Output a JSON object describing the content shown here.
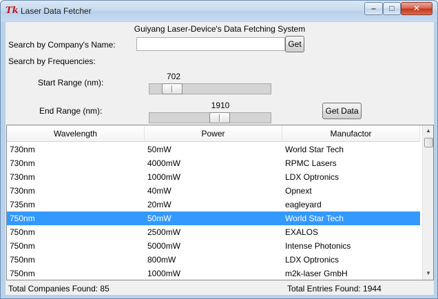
{
  "window": {
    "title": "Laser Data Fetcher",
    "icon": "tk-feather-icon"
  },
  "header": {
    "title": "Guiyang Laser-Device's Data Fetching System"
  },
  "search": {
    "company_label": "Search by Company's Name:",
    "company_value": "",
    "get_label": "Get",
    "freq_label": "Search by Frequencies:"
  },
  "range": {
    "start_label": "Start Range (nm):",
    "start_value": "702",
    "end_label": "End Range (nm):",
    "end_value": "1910",
    "get_data_label": "Get Data"
  },
  "table": {
    "columns": [
      "Wavelength",
      "Power",
      "Manufactor"
    ],
    "rows": [
      [
        "730nm",
        "50mW",
        "World Star Tech"
      ],
      [
        "730nm",
        "4000mW",
        "RPMC Lasers"
      ],
      [
        "730nm",
        "1000mW",
        "LDX Optronics"
      ],
      [
        "730nm",
        "40mW",
        "Opnext"
      ],
      [
        "735nm",
        "20mW",
        "eagleyard"
      ],
      [
        "750nm",
        "50mW",
        "World Star Tech"
      ],
      [
        "750nm",
        "2500mW",
        "EXALOS"
      ],
      [
        "750nm",
        "5000mW",
        "Intense Photonics"
      ],
      [
        "750nm",
        "800mW",
        "LDX Optronics"
      ],
      [
        "750nm",
        "1000mW",
        "m2k-laser GmbH"
      ]
    ],
    "selected_row": 5
  },
  "footer": {
    "companies": "Total Companies Found: 85",
    "entries": "Total Entries Found: 1944"
  },
  "colors": {
    "selection": "#3399ff",
    "titlebar": "#c4d8ee",
    "close_button": "#c4331a"
  }
}
